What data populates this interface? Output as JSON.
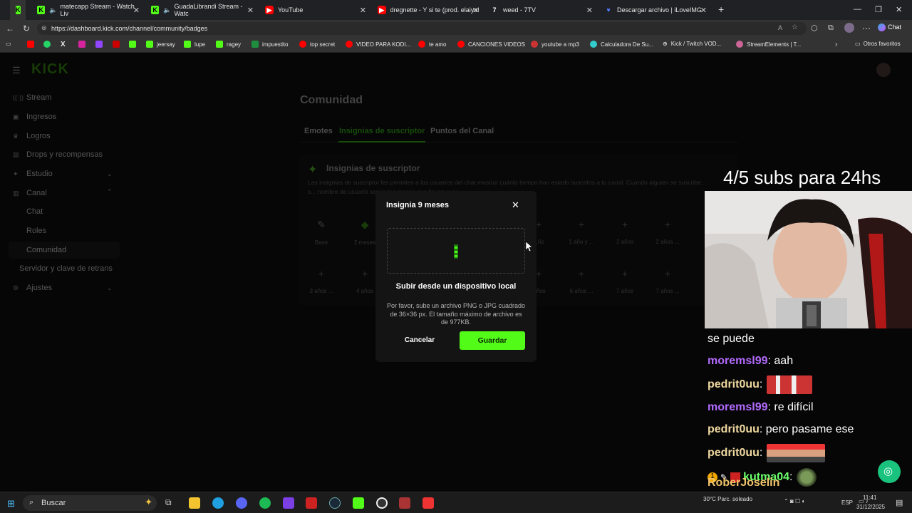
{
  "browser": {
    "tabs": [
      {
        "title": "",
        "icon": "kick-icon",
        "active": true
      },
      {
        "title": "matecapp Stream - Watch Liv",
        "icon": "kick-icon"
      },
      {
        "title": "GuadaLibrandi Stream - Watc",
        "icon": "kick-icon"
      },
      {
        "title": "YouTube",
        "icon": "youtube-icon"
      },
      {
        "title": "dregnette - Y si te (prod. elaiyah, d",
        "icon": "youtube-icon"
      },
      {
        "title": "weed - 7TV",
        "icon": "7tv-icon"
      },
      {
        "title": "Descargar archivo | iLoveIMG",
        "icon": "heart-icon"
      }
    ],
    "new_tab": "+",
    "url": "https://dashboard.kick.com/channel/community/badges",
    "chat_label": "Chat",
    "bookmarks": [
      "jeersay",
      "lupe",
      "ragey",
      "impuestito",
      "top secret",
      "VIDEO PARA KODI...",
      "te amo",
      "CANCIONES VIDEOS",
      "youtube a mp3",
      "Calculadora De Su...",
      "Kick / Twitch VOD...",
      "StreamElements | T..."
    ],
    "other_favorites": "Otros favoritos"
  },
  "kick": {
    "logo": "KICK",
    "sidebar": {
      "items": [
        {
          "label": "Stream",
          "icon": "stream-icon"
        },
        {
          "label": "Ingresos",
          "icon": "money-icon"
        },
        {
          "label": "Logros",
          "icon": "trophy-icon"
        },
        {
          "label": "Drops y recompensas",
          "icon": "gift-icon"
        },
        {
          "label": "Estudio",
          "icon": "studio-icon"
        },
        {
          "label": "Canal",
          "icon": "channel-icon"
        }
      ],
      "canal_sub": [
        "Chat",
        "Roles",
        "Comunidad"
      ],
      "server_key": "Servidor y clave de retrans",
      "settings": "Ajustes"
    },
    "page_title": "Comunidad",
    "tabs": [
      "Emotes",
      "Insignias de suscriptor",
      "Puntos del Canal"
    ],
    "badge_card": {
      "title": "Insignias de suscriptor",
      "description": "Las insignias de suscriptor les permiten a los usuarios del chat mostrar cuánto tiempo han estado suscritos a tu canal. Cuando alguien se suscribe, s... nombre de usuario según los meses que llevan susc..."
    },
    "slots_row1": [
      "Base",
      "2 meses",
      "",
      "",
      "...ño",
      "1 año y ...",
      "2 años",
      "2 años ..."
    ],
    "slots_row2": [
      "3 años ...",
      "4 años",
      "",
      "",
      "...ños",
      "6 años ...",
      "7 años",
      "7 años ..."
    ]
  },
  "modal": {
    "title": "Insignia 9 meses",
    "upload_label": "Subir desde un dispositivo local",
    "hint": "Por favor, sube un archivo PNG o JPG cuadrado de 36×36 px. El tamaño máximo de archivo es de 977KB.",
    "cancel": "Cancelar",
    "save": "Guardar"
  },
  "stream_overlay": {
    "subs_goal": "4/5 subs para 24hs",
    "chat": [
      {
        "user": "",
        "text": "se puede",
        "color": "#ffffff"
      },
      {
        "user": "moremsl99",
        "text": ": aah",
        "color": "#b36bff"
      },
      {
        "user": "pedrit0uu",
        "text": ":",
        "color": "#f0d9a0",
        "emote": true
      },
      {
        "user": "moremsl99",
        "text": ": re difícil",
        "color": "#b36bff"
      },
      {
        "user": "pedrit0uu",
        "text": ": pero pasame ese",
        "color": "#f0d9a0"
      },
      {
        "user": "pedrit0uu",
        "text": ":",
        "color": "#f0d9a0",
        "emote": true
      },
      {
        "user": "kutma04",
        "text": ":",
        "color": "#6bff6b",
        "emote": true
      },
      {
        "user": "RoberJoselin",
        "text": ":",
        "color": "#f0c36b"
      }
    ]
  },
  "taskbar": {
    "search": "Buscar",
    "temp": "30°C",
    "weather": "Parc. soleado",
    "lang": "ESP",
    "time": "11:41",
    "date": "31/12/2025"
  },
  "colors": {
    "kick_green": "#53fc18",
    "chat_purple": "#b36bff",
    "chat_gold": "#f0d9a0"
  }
}
